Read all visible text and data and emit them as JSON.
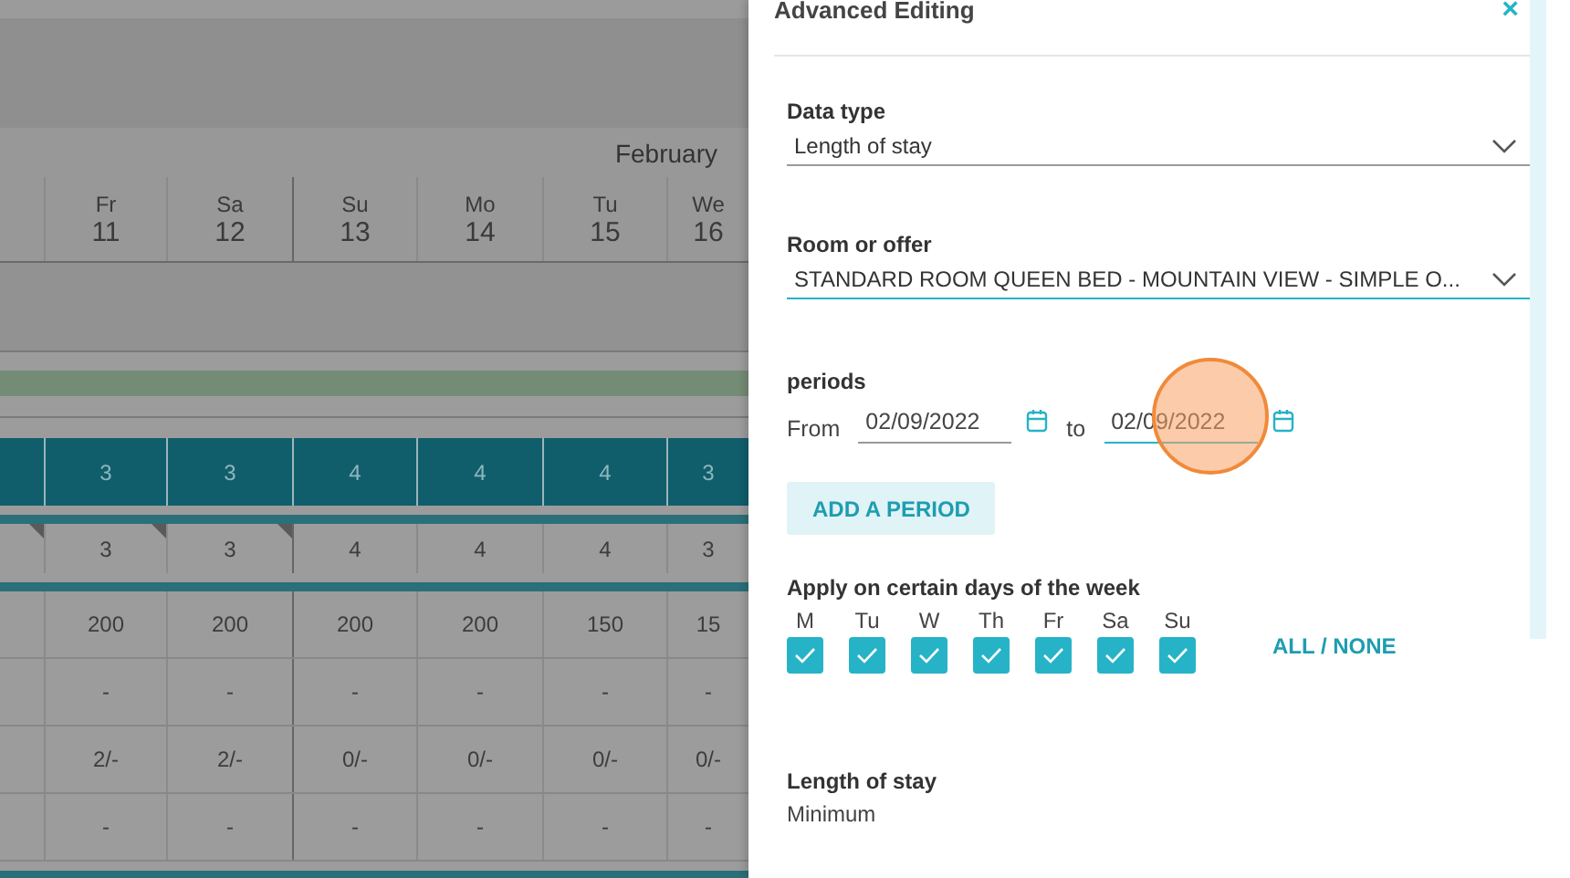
{
  "calendar": {
    "month": "February",
    "days": [
      {
        "weekday": "Fr",
        "day": "11",
        "week_start": false
      },
      {
        "weekday": "Sa",
        "day": "12",
        "week_start": false
      },
      {
        "weekday": "Su",
        "day": "13",
        "week_start": true
      },
      {
        "weekday": "Mo",
        "day": "14",
        "week_start": false
      },
      {
        "weekday": "Tu",
        "day": "15",
        "week_start": false
      },
      {
        "weekday": "We",
        "day": "16",
        "week_start": false
      }
    ],
    "rows": [
      {
        "kind": "highlight",
        "cells": [
          {
            "text": "3"
          },
          {
            "text": "3"
          },
          {
            "text": "4"
          },
          {
            "text": "4"
          },
          {
            "text": "4"
          },
          {
            "text": "3"
          }
        ]
      },
      {
        "kind": "boxed",
        "lead_flagged": true,
        "cells": [
          {
            "text": "3",
            "flagged": true
          },
          {
            "text": "3",
            "flagged": true
          },
          {
            "text": "4",
            "flagged": false
          },
          {
            "text": "4",
            "flagged": false
          },
          {
            "text": "4",
            "flagged": false
          },
          {
            "text": "3",
            "flagged": false
          }
        ]
      },
      {
        "kind": "plain",
        "cells": [
          {
            "text": "200"
          },
          {
            "text": "200"
          },
          {
            "text": "200"
          },
          {
            "text": "200"
          },
          {
            "text": "150"
          },
          {
            "text": "15"
          }
        ]
      },
      {
        "kind": "plain",
        "cells": [
          {
            "text": "-"
          },
          {
            "text": "-"
          },
          {
            "text": "-"
          },
          {
            "text": "-"
          },
          {
            "text": "-"
          },
          {
            "text": "-"
          }
        ]
      },
      {
        "kind": "plain",
        "cells": [
          {
            "text": "2/-"
          },
          {
            "text": "2/-"
          },
          {
            "text": "0/-"
          },
          {
            "text": "0/-"
          },
          {
            "text": "0/-"
          },
          {
            "text": "0/-"
          }
        ]
      },
      {
        "kind": "plain",
        "cells": [
          {
            "text": "-"
          },
          {
            "text": "-"
          },
          {
            "text": "-"
          },
          {
            "text": "-"
          },
          {
            "text": "-"
          },
          {
            "text": "-"
          }
        ]
      }
    ]
  },
  "panel": {
    "title": "Advanced Editing",
    "close": "×",
    "selects": [
      {
        "label": "Data type",
        "value": "Length of stay",
        "focused": false
      },
      {
        "label": "Room or offer",
        "value": "STANDARD ROOM QUEEN BED - MOUNTAIN VIEW - SIMPLE O...",
        "focused": true
      }
    ],
    "periods": {
      "label": "periods",
      "from_label": "From",
      "from": {
        "value": "02/09/2022",
        "focused": false
      },
      "to_label": "to",
      "to": {
        "value": "02/09/2022",
        "focused": true
      },
      "add_button": "ADD A PERIOD"
    },
    "weekdays": {
      "label": "Apply on certain days of the week",
      "all_none": "ALL / NONE",
      "days": [
        {
          "label": "M",
          "checked": true
        },
        {
          "label": "Tu",
          "checked": true
        },
        {
          "label": "W",
          "checked": true
        },
        {
          "label": "Th",
          "checked": true
        },
        {
          "label": "Fr",
          "checked": true
        },
        {
          "label": "Sa",
          "checked": true
        },
        {
          "label": "Su",
          "checked": true
        }
      ]
    },
    "length_of_stay": {
      "label": "Length of stay",
      "sublabel": "Minimum"
    }
  }
}
